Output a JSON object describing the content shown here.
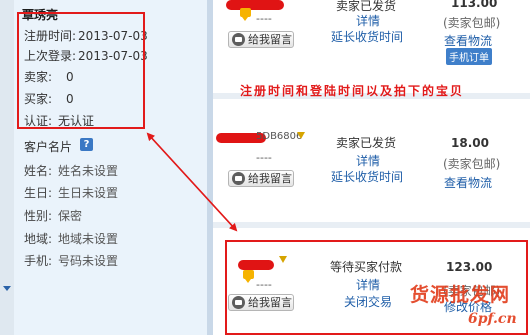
{
  "profile": {
    "username": "覃琇亮",
    "rows": [
      {
        "key": "注册时间:",
        "value": "2013-07-03"
      },
      {
        "key": "上次登录:",
        "value": "2013-07-03"
      },
      {
        "key": "卖家:",
        "value": "0"
      },
      {
        "key": "买家:",
        "value": "0"
      },
      {
        "key": "认证:",
        "value": "无认证"
      }
    ]
  },
  "card": {
    "title": "客户名片",
    "help_glyph": "?",
    "rows": [
      {
        "key": "姓名:",
        "value": "姓名未设置"
      },
      {
        "key": "生日:",
        "value": "生日未设置"
      },
      {
        "key": "性别:",
        "value": "保密"
      },
      {
        "key": "地域:",
        "value": "地域未设置"
      },
      {
        "key": "手机:",
        "value": "号码未设置"
      }
    ]
  },
  "orders": [
    {
      "dash": "----",
      "msg_label": "给我留言",
      "status": "卖家已发货",
      "link1": "详情",
      "link2": "延长收货时间",
      "price": "113.00",
      "price_note": "(卖家包邮)",
      "action": "查看物流",
      "phone_label": "手机订单"
    },
    {
      "partial_id": "5DB6806",
      "dash": "----",
      "msg_label": "给我留言",
      "status": "卖家已发货",
      "link1": "详情",
      "link2": "延长收货时间",
      "price": "18.00",
      "price_note": "(卖家包邮)",
      "action": "查看物流"
    },
    {
      "dash": "----",
      "msg_label": "给我留言",
      "status": "等待买家付款",
      "link1": "详情",
      "link2": "关闭交易",
      "price": "123.00",
      "price_note": "(卖家包邮)",
      "action": "修改价格"
    }
  ],
  "annotation": "注册时间和登陆时间以及拍下的宝贝",
  "watermark": {
    "line1": "货源批发网",
    "line2": "6pf.cn"
  },
  "colors": {
    "annotation_red": "#e21a1a",
    "link_blue": "#1f5ea8",
    "panel_bg": "#eaf3fb"
  }
}
